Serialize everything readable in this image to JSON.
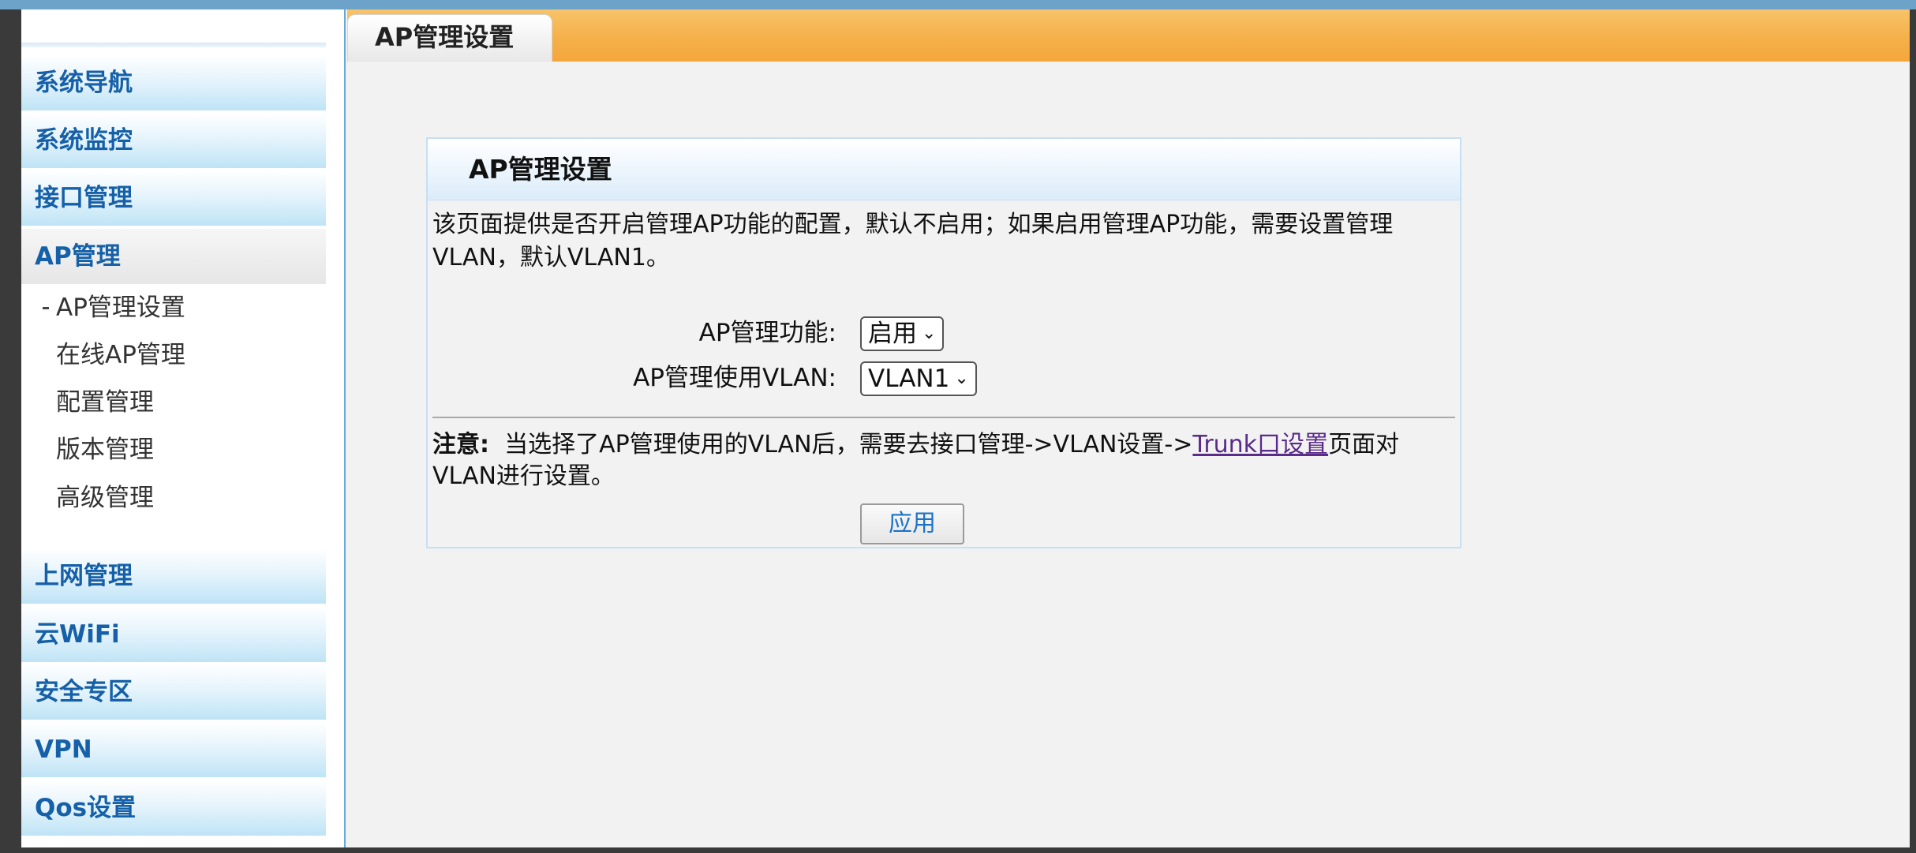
{
  "sidebar": {
    "groups_top": [
      "系统导航",
      "系统监控",
      "接口管理",
      "AP管理"
    ],
    "ap_items": [
      "AP管理设置",
      "在线AP管理",
      "配置管理",
      "版本管理",
      "高级管理"
    ],
    "groups_bottom": [
      "上网管理",
      "云WiFi",
      "安全专区",
      "VPN",
      "Qos设置"
    ]
  },
  "tab": {
    "label": "AP管理设置"
  },
  "panel": {
    "title": "AP管理设置",
    "description": "该页面提供是否开启管理AP功能的配置，默认不启用；如果启用管理AP功能，需要设置管理VLAN，默认VLAN1。",
    "ap_function": {
      "label": "AP管理功能:",
      "value": "启用"
    },
    "ap_vlan": {
      "label": "AP管理使用VLAN:",
      "value": "VLAN1"
    },
    "note": {
      "prefix": "注意:",
      "text_before": "当选择了AP管理使用的VLAN后，需要去接口管理->VLAN设置->",
      "link": "Trunk口设置",
      "text_after": "页面对VLAN进行设置。"
    },
    "apply_label": "应用"
  },
  "colors": {
    "menu_text": "#1560a8",
    "tab_bar": "#f6b04a",
    "link": "#5a2b8a",
    "apply_text": "#1a73c8"
  }
}
